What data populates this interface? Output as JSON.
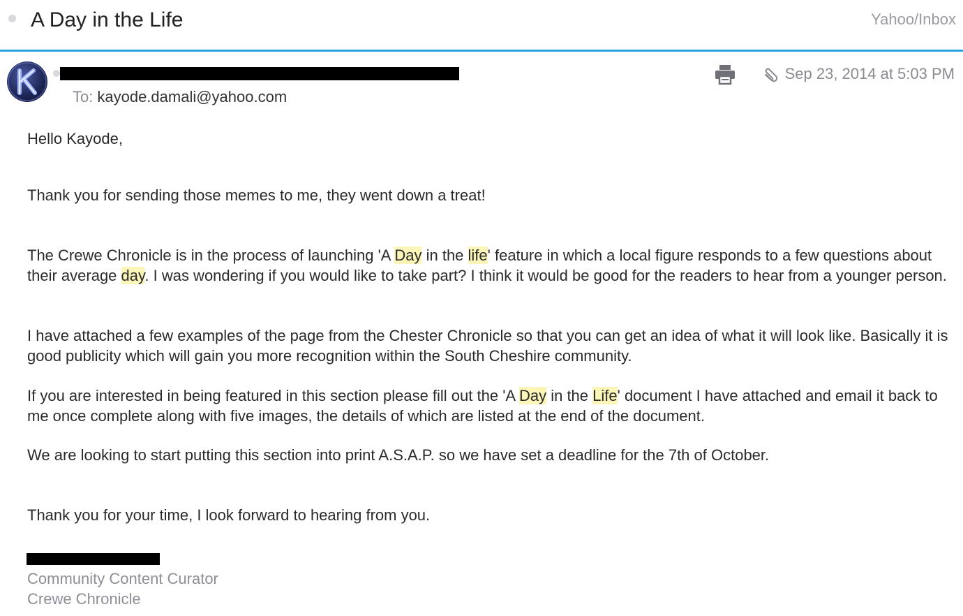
{
  "header": {
    "subject": "A Day in the Life",
    "folder_path": "Yahoo/Inbox"
  },
  "message": {
    "to_label": "To:",
    "to_address": "kayode.damali@yahoo.com",
    "date": "Sep 23, 2014 at 5:03 PM",
    "avatar_letter": "K",
    "icons": [
      "print-icon",
      "attachment-icon"
    ],
    "accent_color": "#27a2e0",
    "highlight_color": "#fbf5b8"
  },
  "body": {
    "greeting": "Hello Kayode,",
    "p1": "Thank you for sending those memes to me, they went down a treat!",
    "p2": {
      "a": "The Crewe Chronicle is in the process of launching  'A ",
      "h1": "Day",
      "b": " in the ",
      "h2": "life",
      "c": "' feature in which a local figure responds to a few questions about their average ",
      "h3": "day",
      "d": ". I was wondering if you would like to take part? I think it would be good for the readers to hear from a younger person."
    },
    "p3": "I have attached a few examples of the page from the Chester Chronicle so that you can get an idea of what it will look like. Basically it is good publicity which will gain you more recognition within the South Cheshire community.",
    "p4": {
      "a": "If you are interested in being featured in this section please fill out the 'A ",
      "h1": "Day",
      "b": " in the ",
      "h2": "Life",
      "c": "' document I have attached and email it back to me once complete along with five images, the details of which are listed at the end of the document."
    },
    "p5": "We are looking to start putting this section into print A.S.A.P. so we have set a deadline for the 7th of October.",
    "p6": "Thank you for your time, I look forward to hearing from you."
  },
  "signature": {
    "title": "Community Content Curator",
    "organization": "Crewe Chronicle"
  }
}
